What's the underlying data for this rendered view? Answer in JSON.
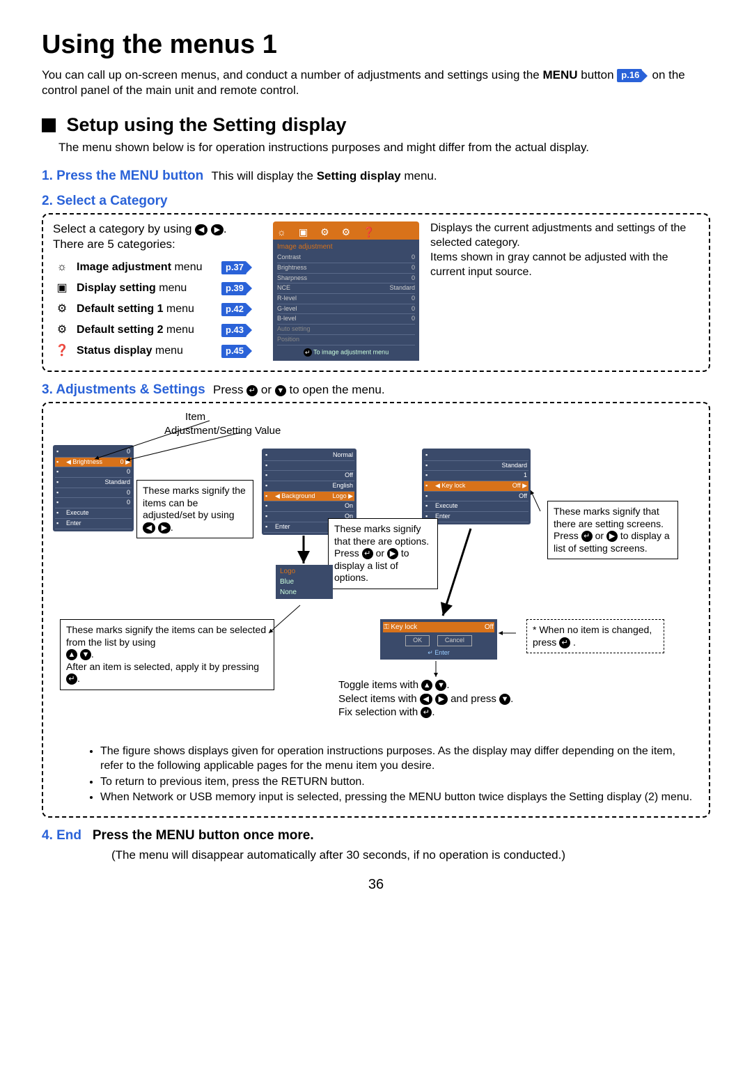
{
  "title": "Using the menus 1",
  "intro_1": "You can call up on-screen menus, and conduct a number of adjustments and settings using the ",
  "intro_menu_bold": "MENU",
  "intro_2": " button ",
  "page_ref_16": "p.16",
  "intro_3": " on the control panel of the main unit and remote control.",
  "section_title": "Setup using the Setting display",
  "section_body": "The menu shown below is for operation instructions purposes and might differ from the actual display.",
  "step1_head": "1. Press the MENU button",
  "step1_aside_a": "This will display the ",
  "step1_aside_bold": "Setting display",
  "step1_aside_b": " menu.",
  "step2_head": "2. Select a Category",
  "select_line_a": "Select a category by using ",
  "select_line_b": ".",
  "select_line_c": "There are 5 categories:",
  "categories": [
    {
      "bold": "Image adjustment",
      "suffix": " menu",
      "ref": "p.37"
    },
    {
      "bold": "Display setting",
      "suffix": " menu",
      "ref": "p.39"
    },
    {
      "bold": "Default setting 1",
      "suffix": " menu",
      "ref": "p.42"
    },
    {
      "bold": "Default setting 2",
      "suffix": " menu",
      "ref": "p.43"
    },
    {
      "bold": "Status display",
      "suffix": " menu",
      "ref": "p.45"
    }
  ],
  "osd_title": "Image adjustment",
  "osd": [
    {
      "k": "Contrast",
      "v": "0"
    },
    {
      "k": "Brightness",
      "v": "0"
    },
    {
      "k": "Sharpness",
      "v": "0"
    },
    {
      "k": "NCE",
      "v": "Standard"
    },
    {
      "k": "R-level",
      "v": "0"
    },
    {
      "k": "G-level",
      "v": "0"
    },
    {
      "k": "B-level",
      "v": "0"
    },
    {
      "k": "Auto setting",
      "v": ""
    },
    {
      "k": "Position",
      "v": ""
    }
  ],
  "osd_foot": "To image adjustment menu",
  "side_note_a": "Displays the current adjustments and settings of the selected category.",
  "side_note_b": "Items shown in gray cannot be adjusted with the current input source.",
  "step3_head": "3. Adjustments & Settings",
  "step3_aside_a": "Press ",
  "step3_aside_b": " or ",
  "step3_aside_c": " to open the menu.",
  "lbl_item": "Item",
  "lbl_value": "Adjustment/Setting Value",
  "osd_left": [
    {
      "k": "",
      "v": "0"
    },
    {
      "k": "Brightness",
      "v": "0",
      "sel": true
    },
    {
      "k": "",
      "v": "0"
    },
    {
      "k": "",
      "v": "Standard"
    },
    {
      "k": "",
      "v": "0"
    },
    {
      "k": "",
      "v": "0"
    },
    {
      "k": "Execute",
      "v": ""
    },
    {
      "k": "Enter",
      "v": ""
    }
  ],
  "osd_mid": [
    {
      "k": "",
      "v": "Normal"
    },
    {
      "k": "",
      "v": ""
    },
    {
      "k": "",
      "v": "Off"
    },
    {
      "k": "",
      "v": "English"
    },
    {
      "k": "Background",
      "v": "Logo",
      "sel": true
    },
    {
      "k": "",
      "v": "On"
    },
    {
      "k": "",
      "v": "On"
    },
    {
      "k": "Enter",
      "v": ""
    }
  ],
  "osd_right": [
    {
      "k": "",
      "v": ""
    },
    {
      "k": "",
      "v": "Standard"
    },
    {
      "k": "",
      "v": "1"
    },
    {
      "k": "Key lock",
      "v": "Off",
      "sel": true
    },
    {
      "k": "",
      "v": "Off"
    },
    {
      "k": "Execute",
      "v": ""
    },
    {
      "k": "Enter",
      "v": ""
    }
  ],
  "callout_leftright": "These marks signify the items can be adjusted/set by using",
  "callout_options_a": "These marks signify that there are options. Press ",
  "callout_options_b": " or ",
  "callout_options_c": " to display a list of options.",
  "callout_screens_a": "These marks signify that there are setting screens. Press ",
  "callout_screens_b": " or ",
  "callout_screens_c": " to display a list of setting screens.",
  "dropdown": [
    "Logo",
    "Blue",
    "None"
  ],
  "callout_updown_a": "These marks signify the items can be selected from the list by using",
  "callout_updown_b": "After an item is selected, apply it by pressing ",
  "keylock_title": "Key lock",
  "keylock_val": "Off",
  "keylock_ok": "OK",
  "keylock_cancel": "Cancel",
  "keylock_enter": "Enter",
  "no_item_note": "* When no item is changed, press ",
  "toggle_a": "Toggle items with ",
  "toggle_b": "Select items with ",
  "toggle_b2": " and press ",
  "toggle_c": "Fix selection with ",
  "period": ".",
  "bullets": [
    "The figure shows displays given for operation instructions purposes.  As the display may differ depending on the item, refer to the following applicable pages for the menu item you desire.",
    "To return to previous item, press the RETURN button.",
    "When Network or USB memory input is selected, pressing the MENU button twice displays the Setting display (2) menu."
  ],
  "step4_head": "4. End",
  "step4_bold": "Press the MENU button once more.",
  "step4_body": "(The menu will disappear automatically after 30 seconds, if no operation is conducted.)",
  "page_number": "36"
}
